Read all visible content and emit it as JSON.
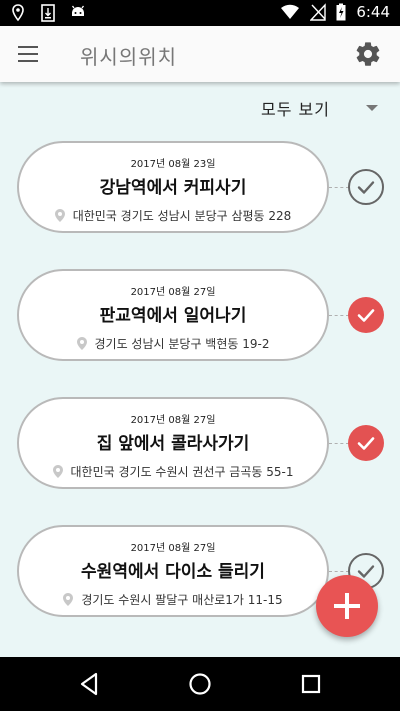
{
  "status_bar": {
    "time": "6:44",
    "icons": [
      "location-icon",
      "sim-card-icon",
      "android-icon",
      "wifi-icon",
      "no-signal-icon",
      "battery-charging-icon"
    ]
  },
  "app_bar": {
    "title": "위시의위치",
    "menu_icon": "hamburger-menu-icon",
    "settings_icon": "gear-icon"
  },
  "filter": {
    "selected": "모두 보기"
  },
  "wishes": [
    {
      "date": "2017년 08월 23일",
      "title": "강남역에서 커피사기",
      "address": "대한민국 경기도 성남시 분당구 삼평동 228",
      "done": false
    },
    {
      "date": "2017년 08월 27일",
      "title": "판교역에서 일어나기",
      "address": "경기도 성남시 분당구 백현동 19-2",
      "done": true
    },
    {
      "date": "2017년 08월 27일",
      "title": "집 앞에서 콜라사가기",
      "address": "대한민국 경기도 수원시 권선구 금곡동 55-1",
      "done": true
    },
    {
      "date": "2017년 08월 27일",
      "title": "수원역에서 다이소 들리기",
      "address": "경기도 수원시 팔달구 매산로1가 11-15",
      "done": false
    }
  ],
  "colors": {
    "accent": "#e85454",
    "background": "#eaf6f6",
    "card_border": "#b9b9b9"
  },
  "fab": {
    "icon": "plus-icon"
  },
  "nav_bar": {
    "icons": [
      "back-icon",
      "home-icon",
      "recents-icon"
    ]
  }
}
